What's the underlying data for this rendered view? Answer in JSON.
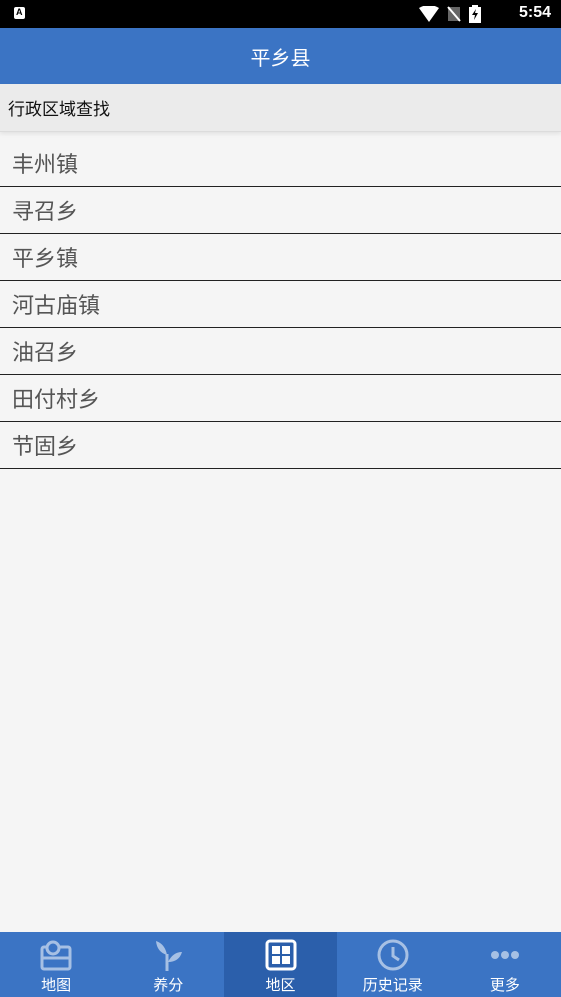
{
  "status_bar": {
    "time": "5:54"
  },
  "app_bar": {
    "title": "平乡县"
  },
  "section": {
    "title": "行政区域查找"
  },
  "list": {
    "items": [
      "丰州镇",
      "寻召乡",
      "平乡镇",
      "河古庙镇",
      "油召乡",
      "田付村乡",
      "节固乡"
    ]
  },
  "bottom_nav": {
    "items": [
      {
        "label": "地图",
        "icon": "map-icon"
      },
      {
        "label": "养分",
        "icon": "plant-icon"
      },
      {
        "label": "地区",
        "icon": "grid-icon",
        "active": true
      },
      {
        "label": "历史记录",
        "icon": "clock-icon"
      },
      {
        "label": "更多",
        "icon": "more-icon"
      }
    ]
  },
  "colors": {
    "primary": "#3b74c4",
    "active_tab": "#2b5fab",
    "list_text": "#555555"
  }
}
